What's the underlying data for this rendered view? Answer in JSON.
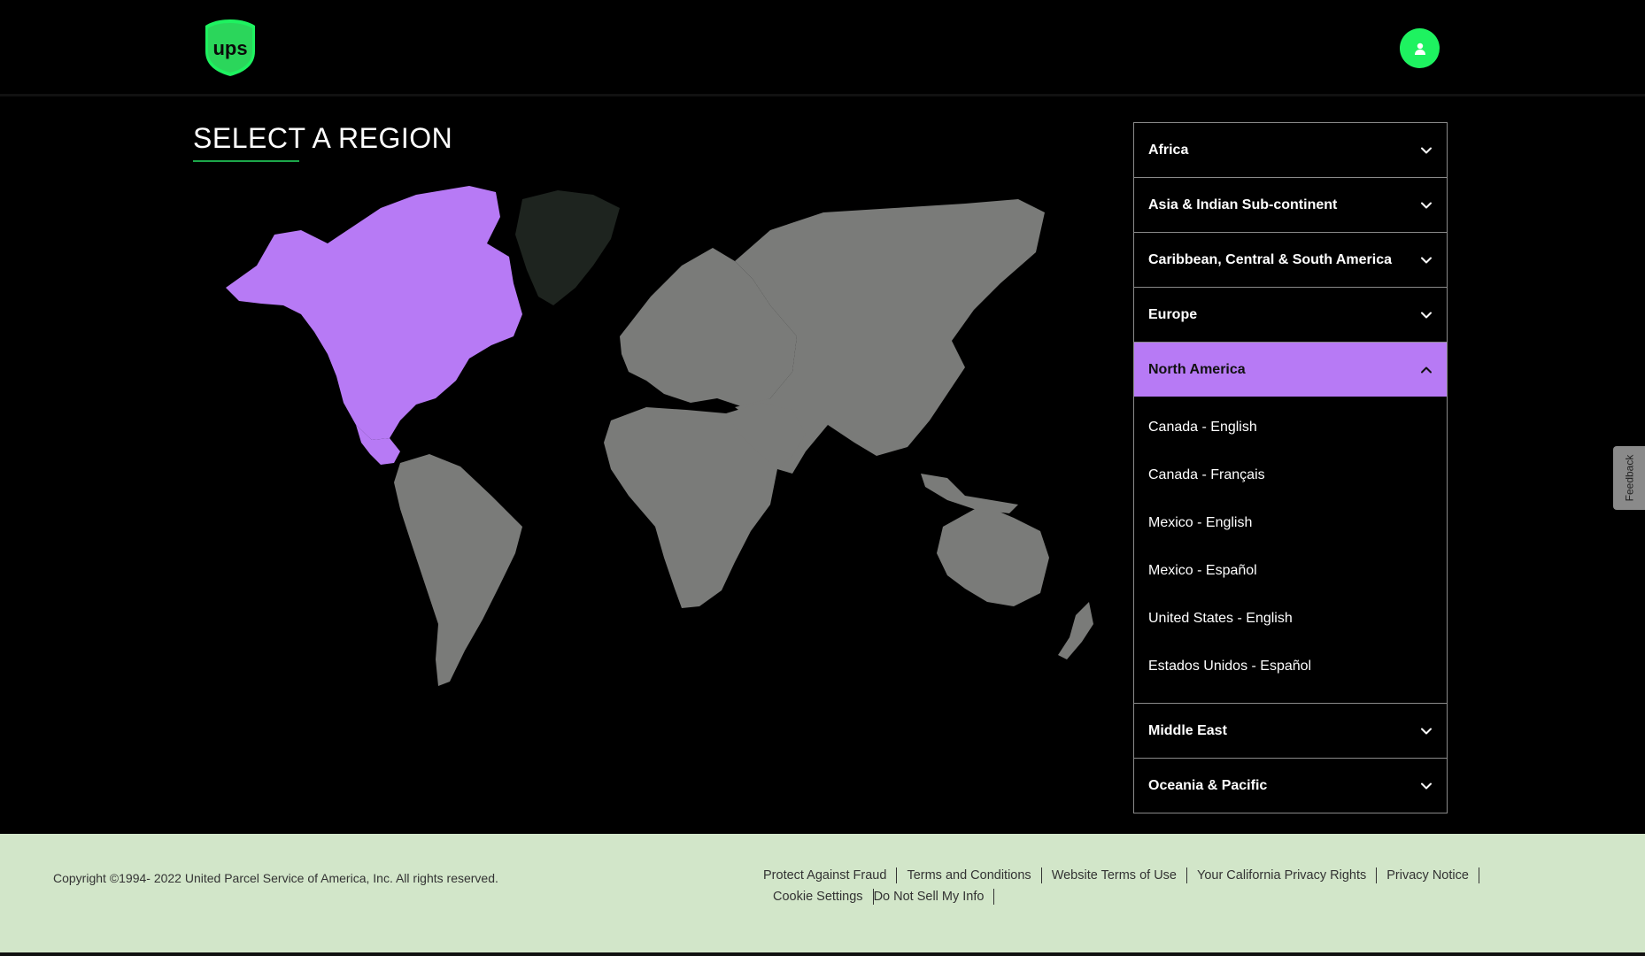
{
  "header": {
    "logo_text": "ups"
  },
  "page_title": "SELECT A REGION",
  "regions": [
    {
      "label": "Africa",
      "expanded": false,
      "items": []
    },
    {
      "label": "Asia & Indian Sub-continent",
      "expanded": false,
      "items": []
    },
    {
      "label": "Caribbean, Central & South America",
      "expanded": false,
      "items": []
    },
    {
      "label": "Europe",
      "expanded": false,
      "items": []
    },
    {
      "label": "North America",
      "expanded": true,
      "items": [
        "Canada - English",
        "Canada - Français",
        "Mexico - English",
        "Mexico - Español",
        "United States - English",
        "Estados Unidos - Español"
      ]
    },
    {
      "label": "Middle East",
      "expanded": false,
      "items": []
    },
    {
      "label": "Oceania & Pacific",
      "expanded": false,
      "items": []
    }
  ],
  "feedback_label": "Feedback",
  "footer": {
    "copyright": "Copyright ©1994- 2022  United Parcel Service of America, Inc. All rights reserved.",
    "links": [
      "Protect Against Fraud",
      "Terms and Conditions",
      "Website Terms of Use",
      "Your California Privacy Rights",
      "Privacy Notice",
      "Cookie Settings",
      "Do Not Sell My Info"
    ]
  },
  "colors": {
    "brand_green": "#1ef260",
    "selected_region": "#b77af5",
    "map_land": "#7a7b79",
    "greenland": "#1e241f",
    "footer_bg": "#d2e6c9"
  },
  "icons": {
    "profile": "user-icon",
    "collapsed": "chevron-down-icon",
    "expanded": "chevron-up-icon"
  }
}
